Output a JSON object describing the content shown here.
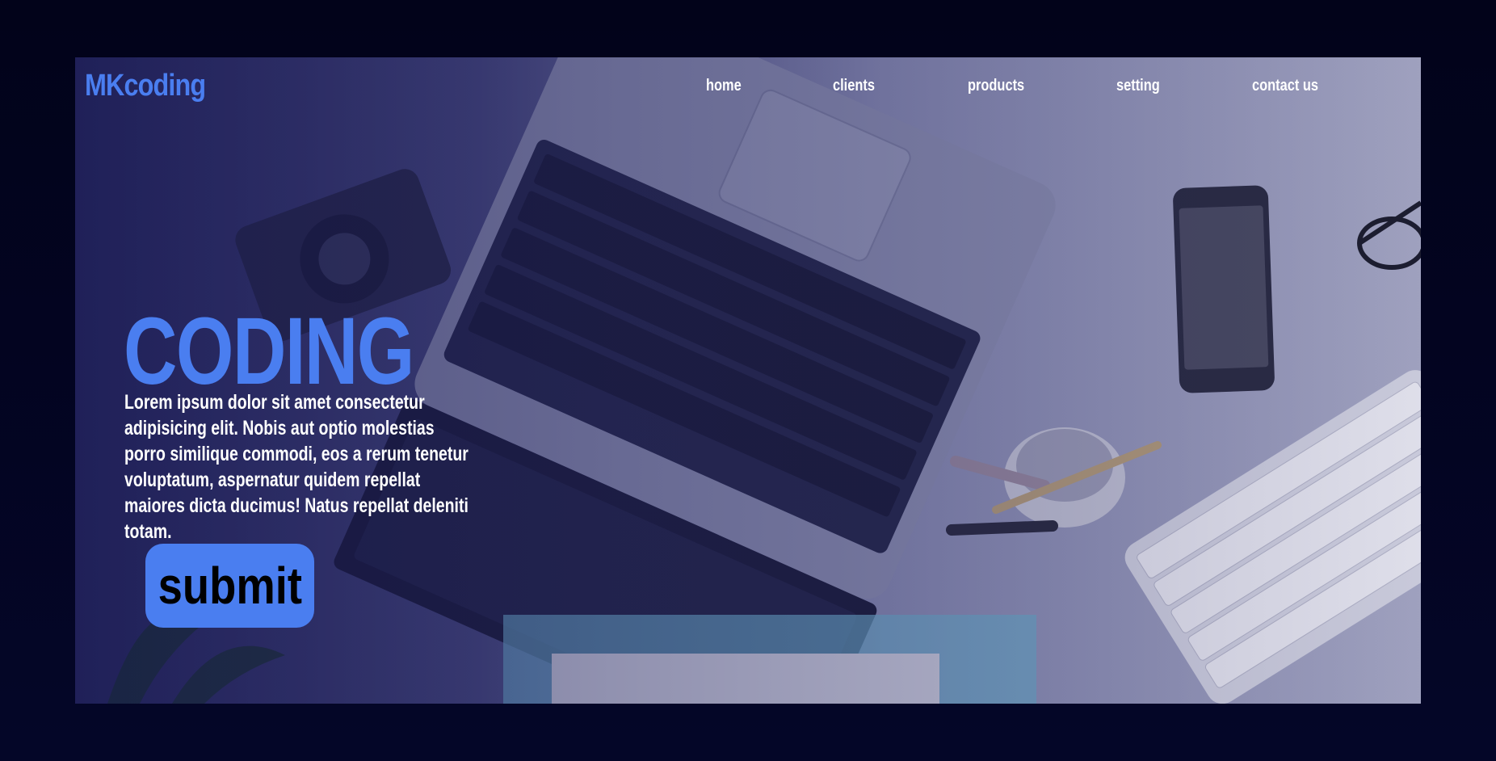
{
  "header": {
    "logo": "MKcoding",
    "nav": [
      "home",
      "clients",
      "products",
      "setting",
      "contact us"
    ]
  },
  "hero": {
    "title": "CODING",
    "description": "Lorem ipsum dolor sit amet consectetur adipisicing elit. Nobis aut optio molestias porro similique commodi, eos a rerum tenetur voluptatum, aspernatur quidem repellat maiores dicta ducimus! Natus repellat deleniti totam.",
    "button": "submit"
  },
  "colors": {
    "accent": "#4a7ef0",
    "page_background": "#02031a",
    "text": "#ffffff",
    "button_text": "#000000"
  }
}
